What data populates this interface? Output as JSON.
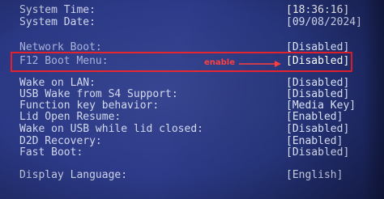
{
  "colors": {
    "background": "#2a3884",
    "text": "#d2d8ee",
    "highlight_box": "#e4202a",
    "annotation": "#ff3a3a"
  },
  "settings": [
    {
      "label": "System Time:",
      "value": "[18:36:16]"
    },
    {
      "label": "System Date:",
      "value": "[09/08/2024]"
    },
    {
      "label": "Network Boot:",
      "value": "[Disabled]"
    },
    {
      "label": "F12 Boot Menu:",
      "value": "[Disabled]"
    },
    {
      "label": "Wake on LAN:",
      "value": "[Disabled]"
    },
    {
      "label": "USB Wake from S4 Support:",
      "value": "[Disabled]"
    },
    {
      "label": "Function key behavior:",
      "value": "[Media Key]"
    },
    {
      "label": "Lid Open Resume:",
      "value": "[Enabled]"
    },
    {
      "label": "Wake on USB while lid closed:",
      "value": "[Disabled]"
    },
    {
      "label": "D2D Recovery:",
      "value": "[Enabled]"
    },
    {
      "label": "Fast Boot:",
      "value": "[Disabled]"
    },
    {
      "label": "Display Language:",
      "value": "[English]"
    }
  ],
  "annotation": {
    "text": "enable",
    "arrow_icon": "arrow-right-icon"
  }
}
